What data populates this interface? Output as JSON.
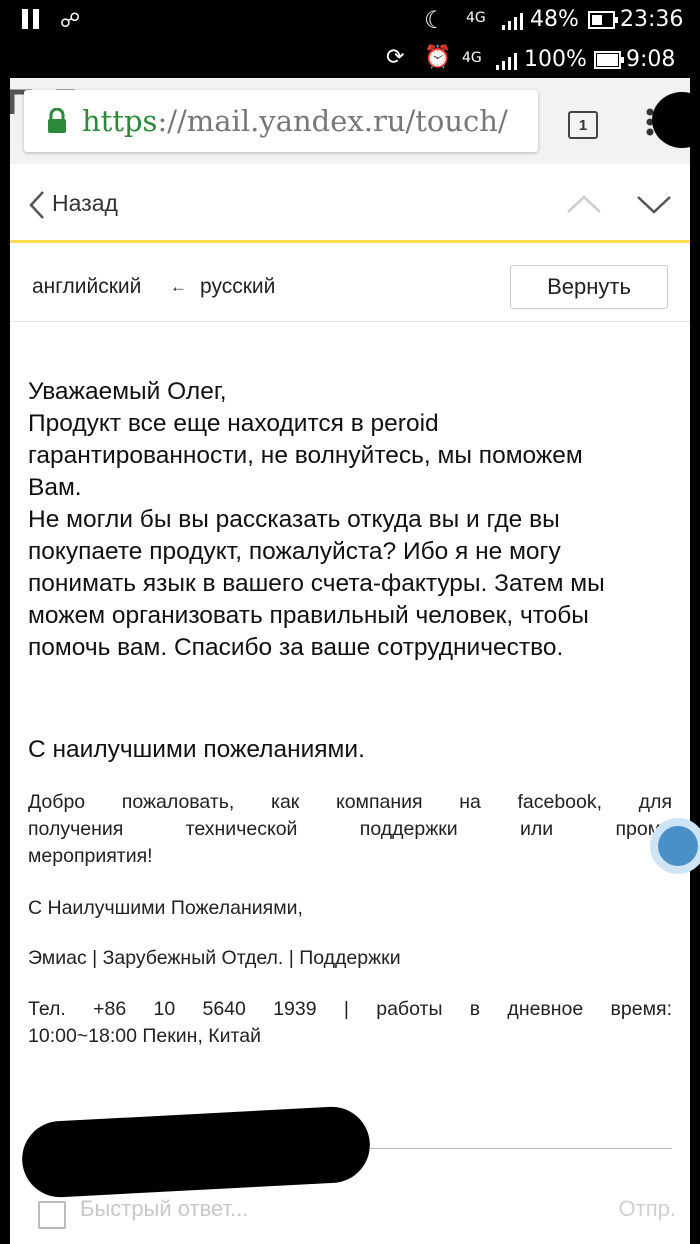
{
  "outer_status": {
    "network": "4G",
    "battery": "48%",
    "time": "23:36"
  },
  "inner_status": {
    "network": "4G",
    "battery": "100%",
    "time": "9:08"
  },
  "browser": {
    "url_scheme": "https",
    "url_rest": "://mail.yandex.ru/touch/",
    "tab_count": "1"
  },
  "nav": {
    "back_label": "Назад"
  },
  "translate": {
    "from_lang": "английский",
    "arrow": "←",
    "to_lang": "русский",
    "revert_label": "Вернуть"
  },
  "message": {
    "lines": [
      "Уважаемый Олег,",
      "Продукт все еще находится в peroid",
      "гарантированности, не волнуйтесь, мы поможем",
      "Вам.",
      "Не могли бы вы рассказать откуда вы и где вы",
      "покупаете продукт, пожалуйста? Ибо я не могу",
      "понимать язык в вашего счета-фактуры. Затем мы",
      "можем организовать правильный человек, чтобы",
      "помочь вам. Спасибо за ваше сотрудничество."
    ],
    "closing": "С наилучшими пожеланиями.",
    "welcome": {
      "line1": "Добро пожаловать, как компания на facebook, для",
      "line2": "получения технической поддержки или промо",
      "line3": "мероприятия!"
    },
    "signoff": "С Наилучшими Пожеланиями,",
    "signature": "Эмиас | Зарубежный Отдел. | Поддержки",
    "contact": {
      "line1": "Тел. +86 10 5640 1939 | работы в дневное время:",
      "line2": "10:00~18:00 Пекин, Китай"
    }
  },
  "reply": {
    "placeholder": "Быстрый ответ...",
    "send_label": "Отпр."
  },
  "colors": {
    "accent_yellow": "#ffdb4d",
    "lock_green": "#2a8a3a"
  }
}
